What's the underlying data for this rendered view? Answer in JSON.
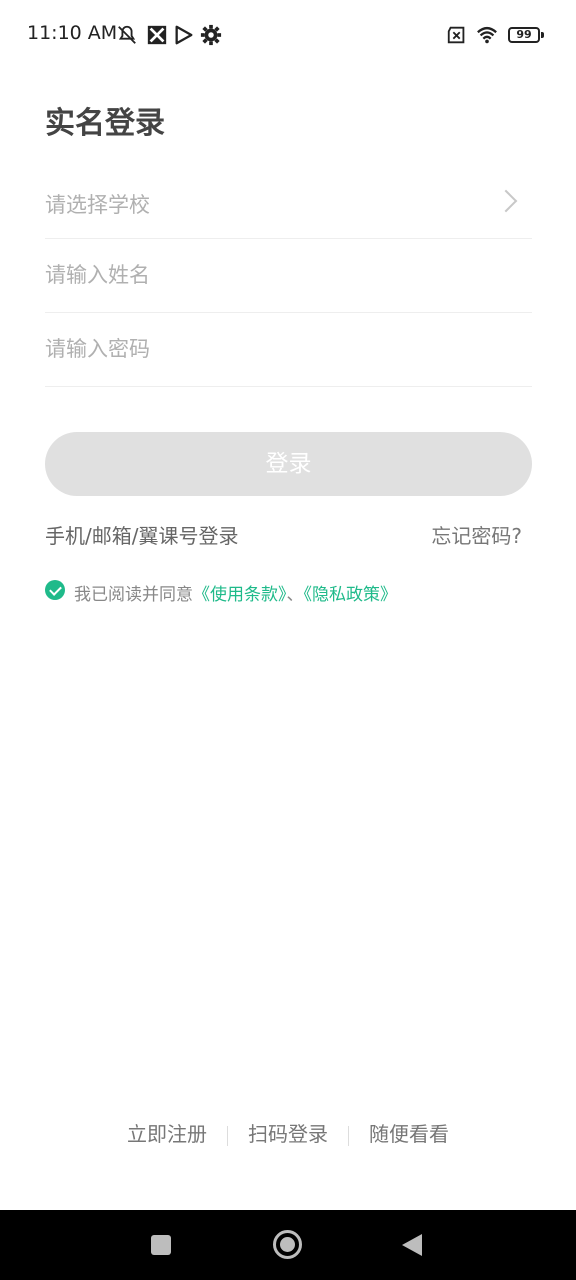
{
  "status_bar": {
    "time": "11:10 AM",
    "battery": "99",
    "icons": [
      "mute-icon",
      "app-icon",
      "play-icon",
      "settings-icon",
      "sim-icon",
      "wifi-icon",
      "battery-icon"
    ]
  },
  "page": {
    "title": "实名登录"
  },
  "form": {
    "school_placeholder": "请选择学校",
    "name_placeholder": "请输入姓名",
    "password_placeholder": "请输入密码"
  },
  "actions": {
    "login_label": "登录",
    "alt_login_label": "手机/邮箱/翼课号登录",
    "forgot_label": "忘记密码?"
  },
  "agreement": {
    "prefix": "我已阅读并同意",
    "terms": "《使用条款》",
    "separator": "、",
    "privacy": "《隐私政策》",
    "checked": true
  },
  "footer": {
    "register": "立即注册",
    "scan_login": "扫码登录",
    "browse": "随便看看"
  },
  "colors": {
    "accent": "#1fba8a",
    "button_disabled": "#e0e0e0"
  }
}
